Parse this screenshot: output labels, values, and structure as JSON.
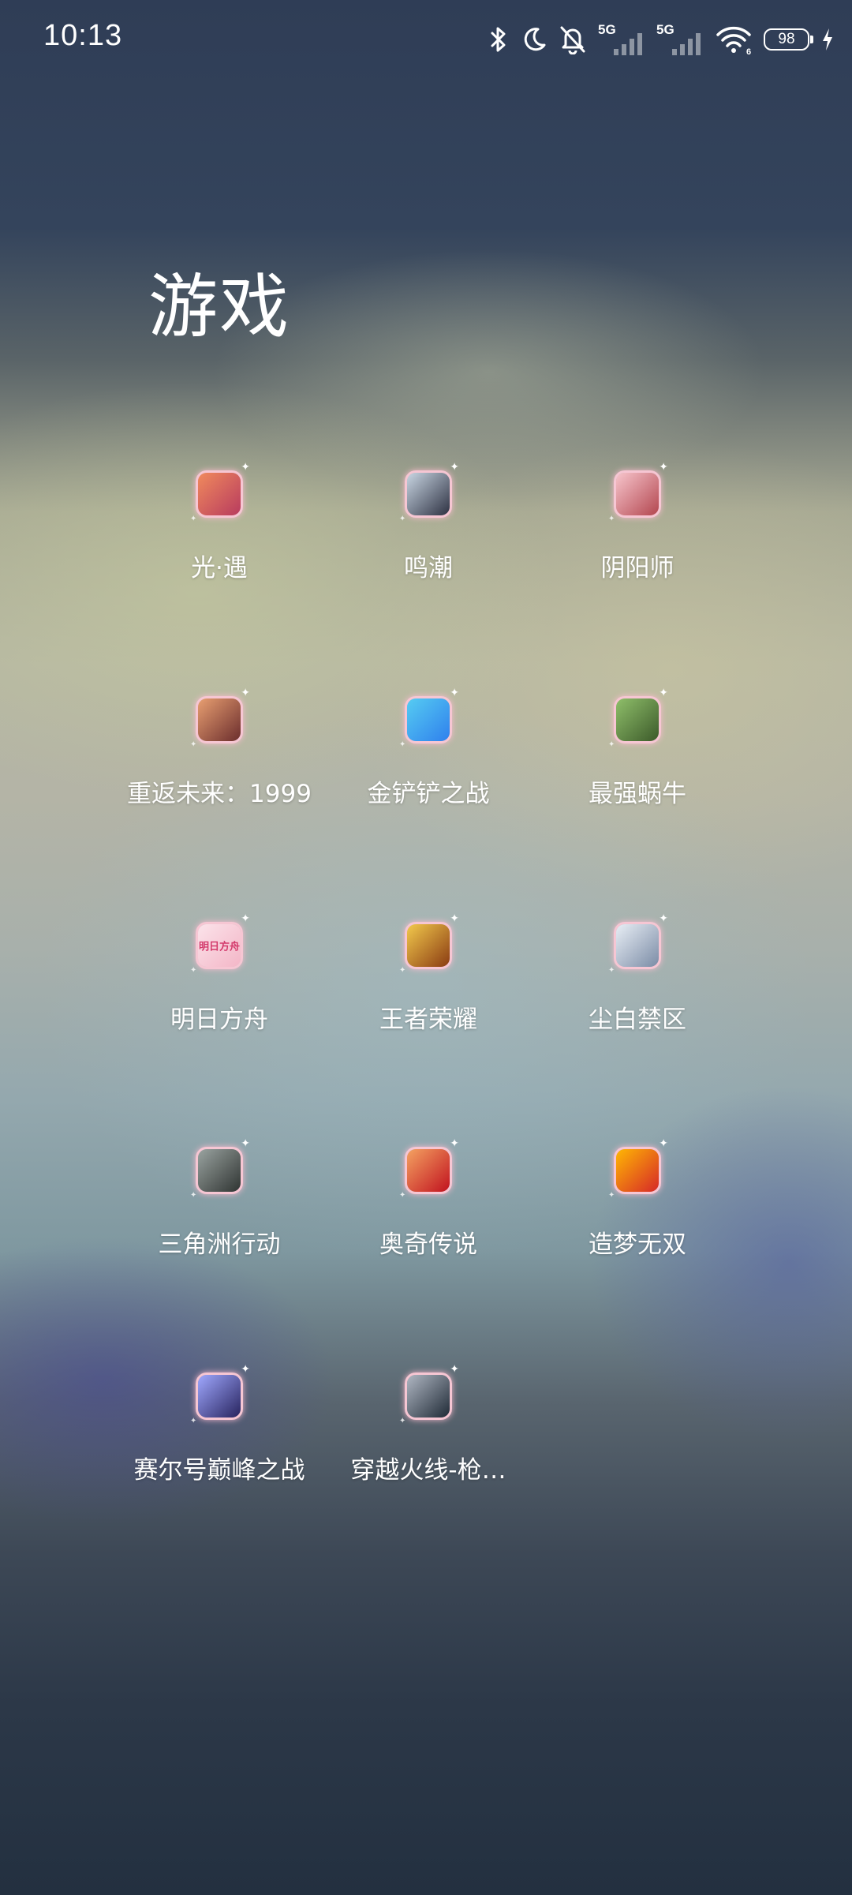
{
  "status_bar": {
    "time": "10:13",
    "icons": [
      "bluetooth-icon",
      "moon-icon",
      "bell-off-icon",
      "signal-5g-icon",
      "signal-5g-icon",
      "wifi-icon",
      "battery-icon",
      "charging-icon"
    ],
    "sim1_label": "5G",
    "sim2_label": "5G",
    "battery_level": "98"
  },
  "folder": {
    "title": "游戏",
    "apps": [
      {
        "label": "光·遇",
        "icon": "sky-children-of-light-icon",
        "colors": [
          "#f08a5d",
          "#b83b5e"
        ]
      },
      {
        "label": "鸣潮",
        "icon": "wuthering-waves-icon",
        "colors": [
          "#c9d6e3",
          "#2d3142"
        ]
      },
      {
        "label": "阴阳师",
        "icon": "onmyoji-icon",
        "colors": [
          "#f7c5cc",
          "#b3464f"
        ]
      },
      {
        "label": "重返未来：1999",
        "icon": "reverse-1999-icon",
        "colors": [
          "#e89f71",
          "#6b2d2d"
        ]
      },
      {
        "label": "金铲铲之战",
        "icon": "golden-spatula-icon",
        "colors": [
          "#56ccf2",
          "#2f80ed"
        ]
      },
      {
        "label": "最强蜗牛",
        "icon": "strongest-snail-icon",
        "colors": [
          "#8fbf6a",
          "#3c5a2a"
        ]
      },
      {
        "label": "明日方舟",
        "icon": "arknights-icon",
        "colors": [
          "#fbe3ea",
          "#f3b6c7"
        ],
        "icon_text": "明日方舟"
      },
      {
        "label": "王者荣耀",
        "icon": "honor-of-kings-icon",
        "colors": [
          "#f2c94c",
          "#8a3b12"
        ]
      },
      {
        "label": "尘白禁区",
        "icon": "snowbreak-icon",
        "colors": [
          "#e8eef5",
          "#7b8ca6"
        ]
      },
      {
        "label": "三角洲行动",
        "icon": "delta-force-icon",
        "colors": [
          "#9aa3a0",
          "#2f3432"
        ]
      },
      {
        "label": "奥奇传说",
        "icon": "aoqi-legend-icon",
        "colors": [
          "#f4a261",
          "#c1121f"
        ]
      },
      {
        "label": "造梦无双",
        "icon": "zaomeng-wushuang-icon",
        "colors": [
          "#ffb703",
          "#d62828"
        ]
      },
      {
        "label": "赛尔号巅峰之战",
        "icon": "seer-peak-battle-icon",
        "colors": [
          "#a0a8ff",
          "#27235e"
        ]
      },
      {
        "label": "穿越火线-枪…",
        "icon": "crossfire-icon",
        "colors": [
          "#b0b7c3",
          "#1f2a36"
        ]
      }
    ]
  }
}
